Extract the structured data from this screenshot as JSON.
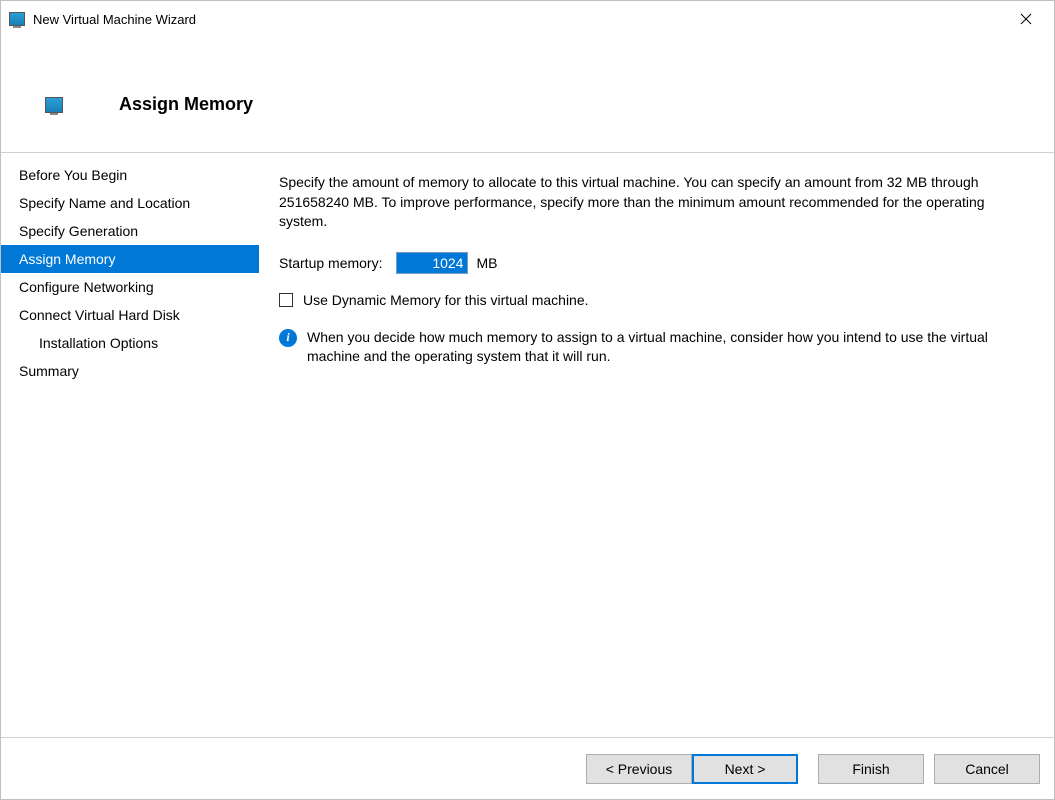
{
  "window": {
    "title": "New Virtual Machine Wizard"
  },
  "header": {
    "title": "Assign Memory"
  },
  "sidebar": {
    "items": [
      {
        "label": "Before You Begin",
        "active": false,
        "indented": false
      },
      {
        "label": "Specify Name and Location",
        "active": false,
        "indented": false
      },
      {
        "label": "Specify Generation",
        "active": false,
        "indented": false
      },
      {
        "label": "Assign Memory",
        "active": true,
        "indented": false
      },
      {
        "label": "Configure Networking",
        "active": false,
        "indented": false
      },
      {
        "label": "Connect Virtual Hard Disk",
        "active": false,
        "indented": false
      },
      {
        "label": "Installation Options",
        "active": false,
        "indented": true
      },
      {
        "label": "Summary",
        "active": false,
        "indented": false
      }
    ]
  },
  "content": {
    "description": "Specify the amount of memory to allocate to this virtual machine. You can specify an amount from 32 MB through 251658240 MB. To improve performance, specify more than the minimum amount recommended for the operating system.",
    "startup_memory_label": "Startup memory:",
    "startup_memory_value": "1024",
    "startup_memory_unit": "MB",
    "dynamic_memory_label": "Use Dynamic Memory for this virtual machine.",
    "dynamic_memory_checked": false,
    "info_text": "When you decide how much memory to assign to a virtual machine, consider how you intend to use the virtual machine and the operating system that it will run."
  },
  "footer": {
    "previous": "< Previous",
    "next": "Next >",
    "finish": "Finish",
    "cancel": "Cancel"
  }
}
